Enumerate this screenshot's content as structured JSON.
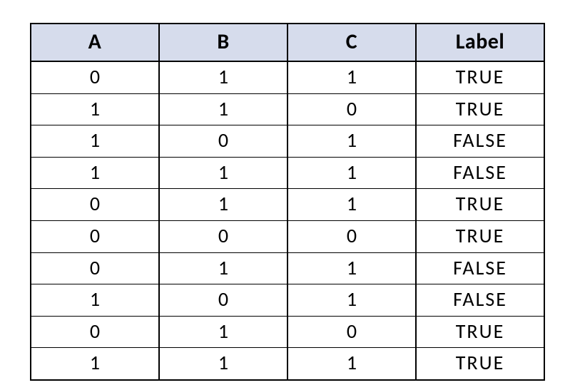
{
  "chart_data": {
    "type": "table",
    "columns": [
      "A",
      "B",
      "C",
      "Label"
    ],
    "rows": [
      [
        "0",
        "1",
        "1",
        "TRUE"
      ],
      [
        "1",
        "1",
        "0",
        "TRUE"
      ],
      [
        "1",
        "0",
        "1",
        "FALSE"
      ],
      [
        "1",
        "1",
        "1",
        "FALSE"
      ],
      [
        "0",
        "1",
        "1",
        "TRUE"
      ],
      [
        "0",
        "0",
        "0",
        "TRUE"
      ],
      [
        "0",
        "1",
        "1",
        "FALSE"
      ],
      [
        "1",
        "0",
        "1",
        "FALSE"
      ],
      [
        "0",
        "1",
        "0",
        "TRUE"
      ],
      [
        "1",
        "1",
        "1",
        "TRUE"
      ]
    ]
  }
}
